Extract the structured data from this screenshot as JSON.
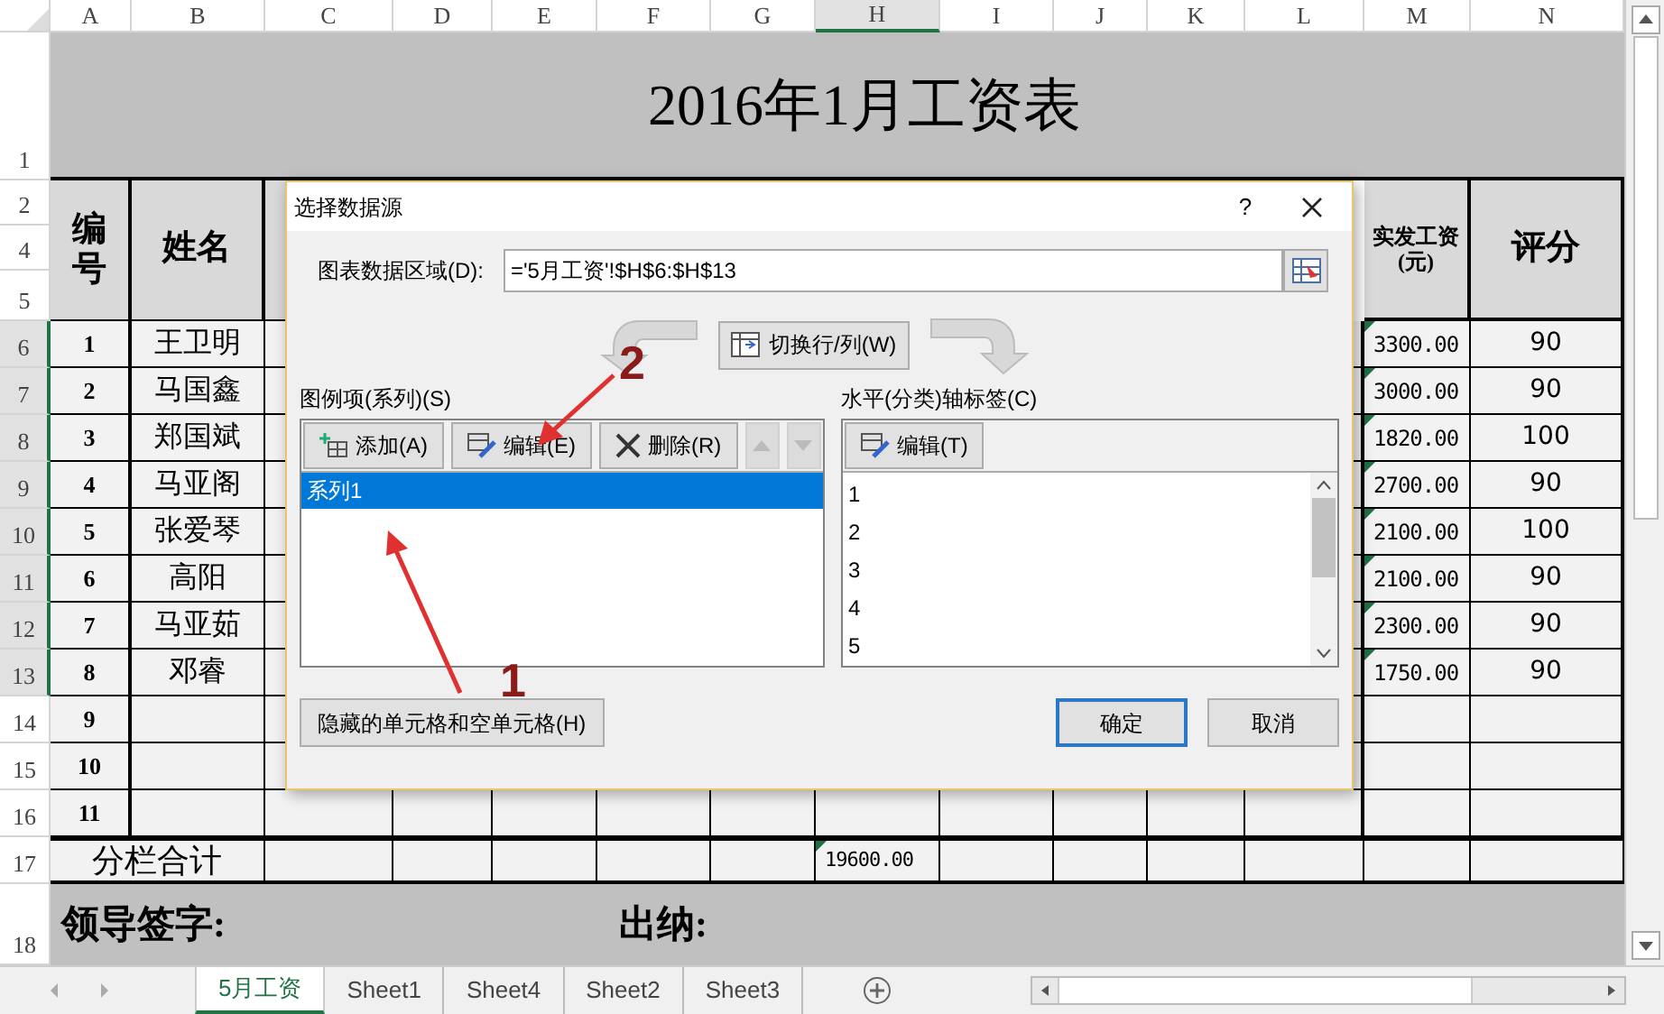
{
  "column_headers": [
    {
      "label": "A",
      "selected": false
    },
    {
      "label": "B",
      "selected": false
    },
    {
      "label": "C",
      "selected": false
    },
    {
      "label": "D",
      "selected": false
    },
    {
      "label": "E",
      "selected": false
    },
    {
      "label": "F",
      "selected": false
    },
    {
      "label": "G",
      "selected": false
    },
    {
      "label": "H",
      "selected": true
    },
    {
      "label": "I",
      "selected": false
    },
    {
      "label": "J",
      "selected": false
    },
    {
      "label": "K",
      "selected": false
    },
    {
      "label": "L",
      "selected": false
    },
    {
      "label": "M",
      "selected": false
    },
    {
      "label": "N",
      "selected": false
    }
  ],
  "row_headers": [
    {
      "label": "1",
      "selected": false
    },
    {
      "label": "2",
      "selected": false
    },
    {
      "label": "4",
      "selected": false
    },
    {
      "label": "5",
      "selected": false
    },
    {
      "label": "6",
      "selected": true
    },
    {
      "label": "7",
      "selected": true
    },
    {
      "label": "8",
      "selected": true
    },
    {
      "label": "9",
      "selected": true
    },
    {
      "label": "10",
      "selected": true
    },
    {
      "label": "11",
      "selected": true
    },
    {
      "label": "12",
      "selected": true
    },
    {
      "label": "13",
      "selected": true
    },
    {
      "label": "14",
      "selected": false
    },
    {
      "label": "15",
      "selected": false
    },
    {
      "label": "16",
      "selected": false
    },
    {
      "label": "17",
      "selected": false
    },
    {
      "label": "18",
      "selected": false
    }
  ],
  "title": "2016年1月工资表",
  "header": {
    "number": "编号",
    "name": "姓名",
    "net_pay": "实发工资(元)",
    "score": "评分"
  },
  "rows": [
    {
      "number": "1",
      "name": "王卫明",
      "net_pay": "3300.00",
      "score": "90"
    },
    {
      "number": "2",
      "name": "马国鑫",
      "net_pay": "3000.00",
      "score": "90"
    },
    {
      "number": "3",
      "name": "郑国斌",
      "net_pay": "1820.00",
      "score": "100"
    },
    {
      "number": "4",
      "name": "马亚阁",
      "net_pay": "2700.00",
      "score": "90"
    },
    {
      "number": "5",
      "name": "张爱琴",
      "net_pay": "2100.00",
      "score": "100"
    },
    {
      "number": "6",
      "name": "高阳",
      "net_pay": "2100.00",
      "score": "90"
    },
    {
      "number": "7",
      "name": "马亚茹",
      "net_pay": "2300.00",
      "score": "90"
    },
    {
      "number": "8",
      "name": "邓睿",
      "net_pay": "1750.00",
      "score": "90"
    },
    {
      "number": "9"
    },
    {
      "number": "10"
    },
    {
      "number": "11"
    }
  ],
  "subtotal": {
    "label": "分栏合计",
    "value": "19600.00"
  },
  "footer": {
    "signature": "领导签字:",
    "cashier": "出纳:"
  },
  "sheet_tabs": [
    {
      "label": "5月工资",
      "selected": true
    },
    {
      "label": "Sheet1",
      "selected": false
    },
    {
      "label": "Sheet4",
      "selected": false
    },
    {
      "label": "Sheet2",
      "selected": false
    },
    {
      "label": "Sheet3",
      "selected": false
    }
  ],
  "dialog": {
    "title": "选择数据源",
    "help": "?",
    "range_label": "图表数据区域(D):",
    "range_value": "='5月工资'!$H$6:$H$13",
    "switch_button": "切换行/列(W)",
    "series_label": "图例项(系列)(S)",
    "series_buttons": [
      {
        "kind": "add",
        "label": "添加(A)"
      },
      {
        "kind": "edit",
        "label": "编辑(E)"
      },
      {
        "kind": "delete",
        "label": "删除(R)"
      },
      {
        "kind": "up",
        "disabled": true
      },
      {
        "kind": "down",
        "disabled": true
      }
    ],
    "series": [
      {
        "label": "系列1",
        "selected": true
      }
    ],
    "axis_label": "水平(分类)轴标签(C)",
    "axis_button": "编辑(T)",
    "axis_items": [
      "1",
      "2",
      "3",
      "4",
      "5"
    ],
    "hidden_cells_button": "隐藏的单元格和空单元格(H)",
    "ok": "确定",
    "cancel": "取消"
  },
  "annotations": [
    {
      "label": "1"
    },
    {
      "label": "2"
    }
  ]
}
